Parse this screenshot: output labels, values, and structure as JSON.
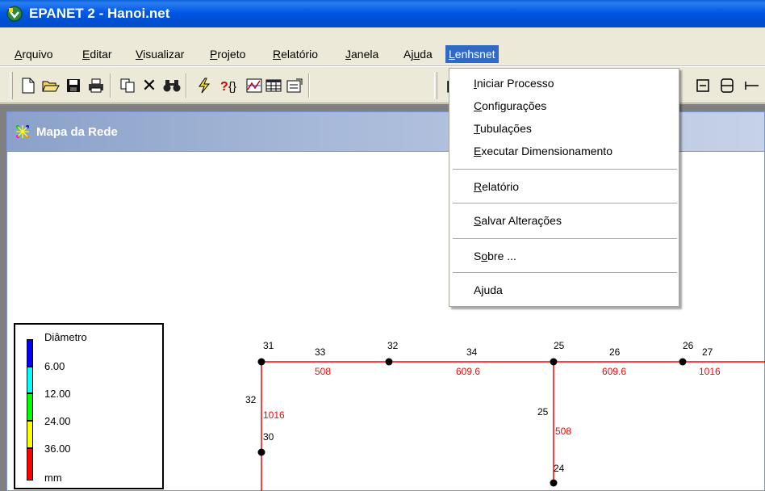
{
  "window": {
    "title": "EPANET 2 - Hanoi.net"
  },
  "menubar": {
    "items": [
      {
        "label": "Arquivo",
        "ul": "A",
        "rest": "rquivo"
      },
      {
        "label": "Editar",
        "ul": "E",
        "rest": "ditar"
      },
      {
        "label": "Visualizar",
        "ul": "V",
        "rest": "isualizar"
      },
      {
        "label": "Projeto",
        "ul": "P",
        "rest": "rojeto"
      },
      {
        "label": "Relatório",
        "ul": "R",
        "rest": "elatório"
      },
      {
        "label": "Janela",
        "ul": "J",
        "rest": "anela"
      },
      {
        "label": "Ajuda",
        "pre": "Aj",
        "ul": "u",
        "rest": "da"
      },
      {
        "label": "Lenhsnet",
        "ul": "L",
        "rest": "enhsnet"
      }
    ]
  },
  "dropdown": {
    "items": [
      {
        "pre": "",
        "ul": "I",
        "rest": "niciar Processo"
      },
      {
        "pre": "",
        "ul": "C",
        "rest": "onfigurações"
      },
      {
        "pre": "",
        "ul": "T",
        "rest": "ubulações"
      },
      {
        "pre": "",
        "ul": "E",
        "rest": "xecutar Dimensionamento"
      },
      {
        "pre": "",
        "ul": "R",
        "rest": "elatório"
      },
      {
        "pre": "",
        "ul": "S",
        "rest": "alvar Alterações"
      },
      {
        "pre": "S",
        "ul": "o",
        "rest": "bre ..."
      },
      {
        "pre": "A",
        "ul": "j",
        "rest": "uda"
      }
    ]
  },
  "map_window": {
    "title": "Mapa da Rede"
  },
  "legend": {
    "title": "Diâmetro",
    "levels": [
      "6.00",
      "12.00",
      "24.00",
      "36.00"
    ],
    "unit": "mm",
    "colors": [
      "#0000ff",
      "#00ffff",
      "#00ff00",
      "#ffff00",
      "#ff0000"
    ]
  },
  "network": {
    "node_labels": [
      "31",
      "32",
      "25",
      "26",
      "30",
      "24"
    ],
    "link_labels": [
      "33",
      "34",
      "26",
      "27",
      "32",
      "25"
    ],
    "diameters": [
      "508",
      "609.6",
      "609.6",
      "1016",
      "1016",
      "508"
    ],
    "link_color": "#ff0000"
  },
  "colors": {
    "titlebar": "#0058e6",
    "menu_highlight": "#316ac5"
  }
}
